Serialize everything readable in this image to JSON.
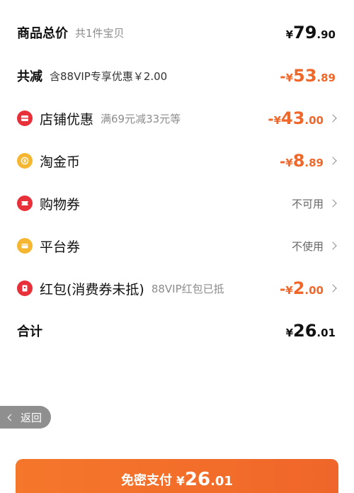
{
  "summary": {
    "goods_total_label": "商品总价",
    "goods_total_sub": "共1件宝贝",
    "goods_total_price": {
      "yen": "¥",
      "int": "79",
      "dec": ".90"
    },
    "reduction_label": "共减",
    "reduction_sub": "含88VIP专享优惠￥2.00",
    "reduction_price": {
      "neg": "-",
      "yen": "¥",
      "int": "53",
      "dec": ".89"
    }
  },
  "discounts": [
    {
      "label": "店铺优惠",
      "sub": "满69元减33元等",
      "neg": "-",
      "yen": "¥",
      "int": "43",
      "dec": ".00",
      "icon": "store-coupon-icon",
      "color": "#e8303a"
    },
    {
      "label": "淘金币",
      "sub": "",
      "neg": "-",
      "yen": "¥",
      "int": "8",
      "dec": ".89",
      "icon": "gold-coin-icon",
      "color": "#f5b731"
    },
    {
      "label": "购物券",
      "status": "不可用",
      "icon": "shopping-voucher-icon",
      "color": "#e8303a"
    },
    {
      "label": "平台券",
      "status": "不使用",
      "icon": "platform-coupon-icon",
      "color": "#f5b731"
    },
    {
      "label": "红包(消费券未抵)",
      "sub": "88VIP红包已抵",
      "neg": "-",
      "yen": "¥",
      "int": "2",
      "dec": ".00",
      "icon": "red-envelope-icon",
      "color": "#e8303a"
    }
  ],
  "total": {
    "label": "合计",
    "price": {
      "yen": "¥",
      "int": "26",
      "dec": ".01"
    }
  },
  "back_button": {
    "label": "返回"
  },
  "pay_button": {
    "label": "免密支付",
    "price": {
      "yen": "¥",
      "int": "26",
      "dec": ".01"
    }
  },
  "colors": {
    "accent": "#f0672a",
    "red_icon": "#e8303a",
    "gold_icon": "#f5b731"
  }
}
